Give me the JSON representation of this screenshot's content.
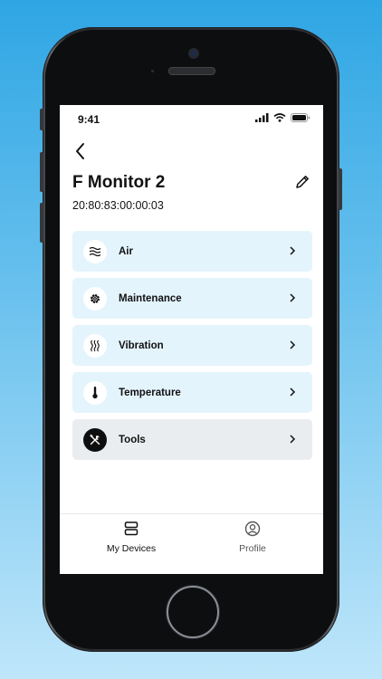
{
  "status": {
    "time": "9:41"
  },
  "device": {
    "name": "F Monitor 2",
    "mac": "20:80:83:00:00:03"
  },
  "menu": [
    {
      "label": "Air",
      "icon": "air-waves-icon"
    },
    {
      "label": "Maintenance",
      "icon": "gear-icon"
    },
    {
      "label": "Vibration",
      "icon": "vibration-icon"
    },
    {
      "label": "Temperature",
      "icon": "thermometer-icon"
    },
    {
      "label": "Tools",
      "icon": "tools-icon"
    }
  ],
  "tabs": [
    {
      "label": "My Devices",
      "icon": "devices-icon"
    },
    {
      "label": "Profile",
      "icon": "profile-icon"
    }
  ],
  "colors": {
    "item_bg": "#e4f4fd",
    "tools_bg": "#eaedf0",
    "background": "#2fa6e4"
  }
}
